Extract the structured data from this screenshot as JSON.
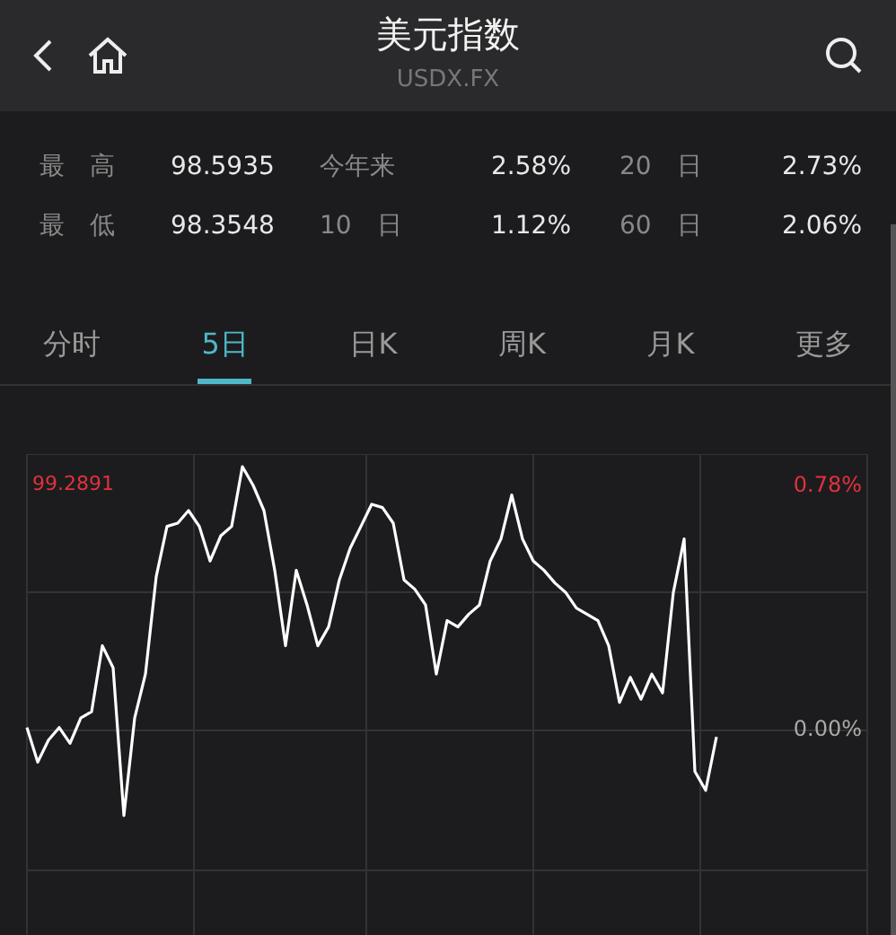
{
  "header": {
    "title": "美元指数",
    "subtitle": "USDX.FX"
  },
  "stats": [
    {
      "label": "最　高",
      "value": "98.5935",
      "label_2": "今年来",
      "value_2": "2.58%",
      "label_3": "20　日",
      "value_3": "2.73%"
    },
    {
      "label": "最　低",
      "value": "98.3548",
      "label_2": "10　日",
      "value_2": "1.12%",
      "label_3": "60　日",
      "value_3": "2.06%"
    }
  ],
  "tabs": [
    {
      "label": "分时",
      "selected": false
    },
    {
      "label": "5日",
      "selected": true
    },
    {
      "label": "日K",
      "selected": false
    },
    {
      "label": "周K",
      "selected": false
    },
    {
      "label": "月K",
      "selected": false
    },
    {
      "label": "更多",
      "selected": false
    }
  ],
  "chart": {
    "high_price": "99.2891",
    "chart_data": {
      "type": "line",
      "grid": true,
      "ylim": [
        -0.65,
        0.88
      ],
      "yticks": [
        {
          "value": 0.78,
          "label": "0.78%"
        },
        {
          "value": 0,
          "label": "0.00%"
        }
      ],
      "series": [
        {
          "color": "#ffffff",
          "values": [
            0.01,
            -0.1,
            -0.03,
            0.01,
            -0.04,
            0.04,
            0.06,
            0.27,
            0.2,
            -0.27,
            0.04,
            0.18,
            0.49,
            0.65,
            0.66,
            0.7,
            0.65,
            0.54,
            0.62,
            0.65,
            0.84,
            0.78,
            0.7,
            0.51,
            0.27,
            0.51,
            0.4,
            0.27,
            0.33,
            0.48,
            0.58,
            0.65,
            0.72,
            0.71,
            0.66,
            0.48,
            0.45,
            0.4,
            0.18,
            0.35,
            0.33,
            0.37,
            0.4,
            0.54,
            0.61,
            0.75,
            0.61,
            0.54,
            0.51,
            0.47,
            0.44,
            0.39,
            0.37,
            0.35,
            0.27,
            0.09,
            0.17,
            0.1,
            0.18,
            0.12,
            0.44,
            0.61,
            -0.13,
            -0.19,
            -0.02,
            null,
            null,
            null,
            null,
            null,
            null,
            null,
            null,
            null,
            null,
            null,
            null,
            null,
            null
          ]
        }
      ]
    }
  }
}
